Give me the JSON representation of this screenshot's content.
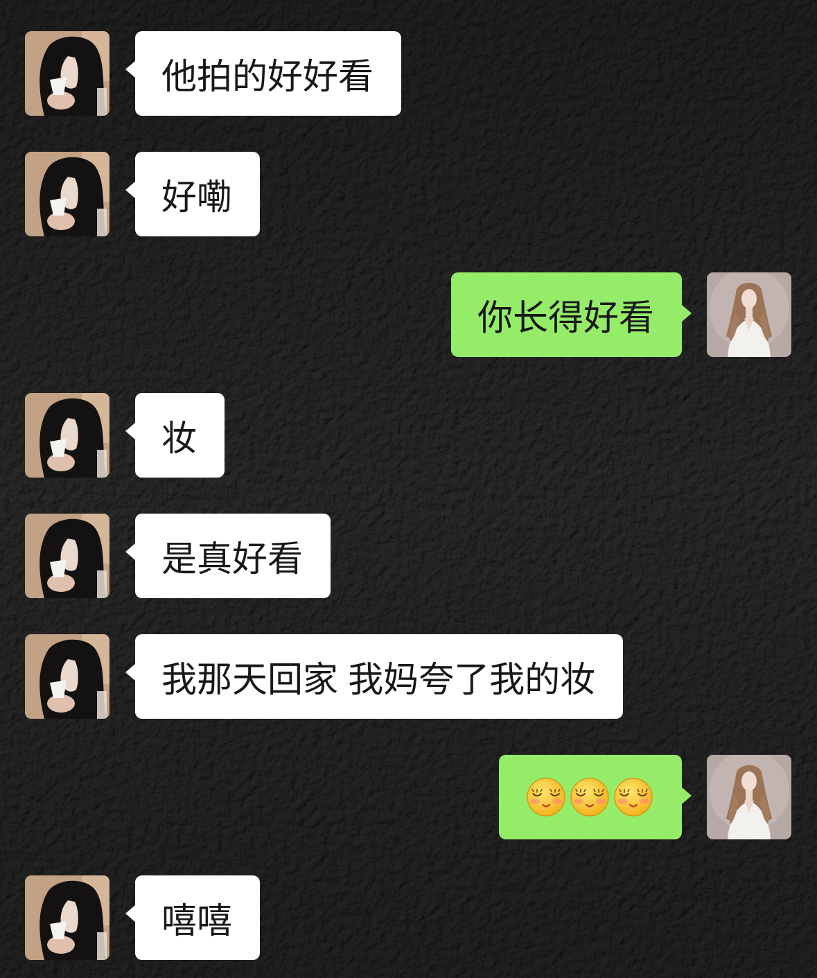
{
  "colors": {
    "background": "#1f1f1f",
    "received_bubble": "#ffffff",
    "sent_bubble": "#95ec69",
    "text": "#181818"
  },
  "avatars": {
    "friend": "friend-avatar",
    "me": "my-avatar"
  },
  "messages": [
    {
      "text": "他拍的好好看"
    },
    {
      "text": "好嘞"
    },
    {
      "text": "你长得好看"
    },
    {
      "text": "妆"
    },
    {
      "text": "是真好看"
    },
    {
      "text": "我那天回家 我妈夸了我的妆"
    },
    {
      "emoji": [
        "shy-face-icon",
        "shy-face-icon",
        "shy-face-icon"
      ]
    },
    {
      "text": "嘻嘻"
    }
  ]
}
